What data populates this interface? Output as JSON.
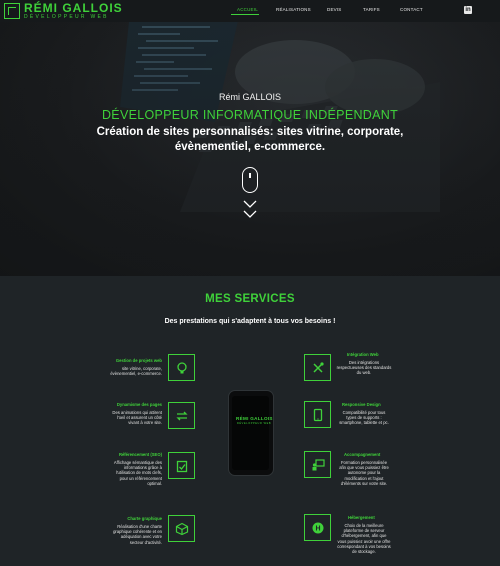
{
  "nav": {
    "logo_name": "RÉMI GALLOIS",
    "logo_sub": "DÉVELOPPEUR WEB",
    "items": [
      {
        "label": "ACCUEIL",
        "active": true
      },
      {
        "label": "RÉALISATIONS",
        "active": false
      },
      {
        "label": "DEVIS",
        "active": false
      },
      {
        "label": "TARIFS",
        "active": false
      },
      {
        "label": "CONTACT",
        "active": false
      }
    ],
    "social_icon": "linkedin-icon",
    "social_glyph": "in"
  },
  "hero": {
    "name": "Rémi GALLOIS",
    "role": "DÉVELOPPEUR INFORMATIQUE INDÉPENDANT",
    "tagline_line1": "Création de sites personnalisés: sites vitrine, corporate,",
    "tagline_line2": "évènementiel, e-commerce."
  },
  "services": {
    "title": "MES SERVICES",
    "subtitle": "Des prestations qui s'adaptent à tous vos besoins !",
    "left": [
      {
        "title": "Gestion de projets web",
        "desc": [
          "site vitrine, corporate,",
          "évènementiel, e-commerce."
        ],
        "icon": "lightbulb-icon"
      },
      {
        "title": "Dynamisme des pages",
        "desc": [
          "Des animations qui attirent",
          "l'oeil et assurent un côté",
          "vivant à votre site."
        ],
        "icon": "swap-arrows-icon"
      },
      {
        "title": "Référencement (SEO)",
        "desc": [
          "Affichage sémantique des",
          "informations grâce à",
          "l'utilisation de mots clefs,",
          "pour un référencement",
          "optimal."
        ],
        "icon": "clipboard-check-icon"
      },
      {
        "title": "Charte graphique",
        "desc": [
          "Réalisation d'une charte",
          "graphique cohérente et en",
          "adéquation avec votre",
          "secteur d'activité."
        ],
        "icon": "palette-box-icon"
      }
    ],
    "right": [
      {
        "title": "Intégration Web",
        "desc": [
          "Des intégrations",
          "respectueuses des standards",
          "du web."
        ],
        "icon": "tools-icon"
      },
      {
        "title": "Responsive Design",
        "desc": [
          "Compatibilité pour tous",
          "types de supports :",
          "smartphone, tablette et pc."
        ],
        "icon": "tablet-icon"
      },
      {
        "title": "Accompagnement",
        "desc": [
          "Formation personnalisée",
          "afin que vous puissiez être",
          "autonome pour la",
          "modification et l'ajout",
          "d'éléments sur votre site."
        ],
        "icon": "teaching-icon"
      },
      {
        "title": "Hébergement",
        "desc": [
          "Choix de la meilleure",
          "plateforme de serveur",
          "d'hébergement, afin que",
          "vous puissiez avoir une offre",
          "correspondant à vos besoins",
          "de stockage."
        ],
        "icon": "hosting-h-icon"
      }
    ]
  },
  "phone": {
    "logo": "RÉMI GALLOIS",
    "logo_sub": "DÉVELOPPEUR WEB"
  },
  "colors": {
    "accent": "#3fd13a",
    "background": "#1f2427",
    "nav_bg": "#16191b"
  }
}
